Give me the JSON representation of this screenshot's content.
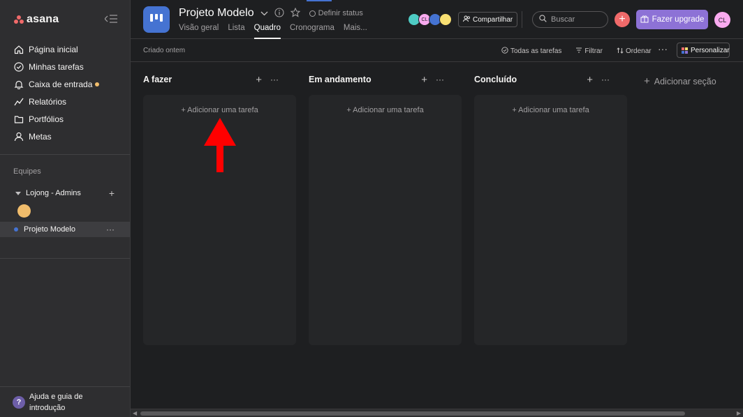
{
  "app": {
    "logo_text": "asana"
  },
  "sidebar": {
    "nav": [
      {
        "label": "Página inicial",
        "icon": "home-icon"
      },
      {
        "label": "Minhas tarefas",
        "icon": "check-circle-icon"
      },
      {
        "label": "Caixa de entrada",
        "icon": "bell-icon"
      },
      {
        "label": "Relatórios",
        "icon": "chart-line-icon"
      },
      {
        "label": "Portfólios",
        "icon": "folder-icon"
      },
      {
        "label": "Metas",
        "icon": "person-icon"
      }
    ],
    "teams_title": "Equipes",
    "team_name": "Lojong - Admins",
    "project_name": "Projeto Modelo",
    "help_text": "Ajuda e guia de introdução"
  },
  "header": {
    "project_title": "Projeto Modelo",
    "status_label": "Definir status",
    "tabs": [
      "Visão geral",
      "Lista",
      "Quadro",
      "Cronograma",
      "Mais..."
    ],
    "active_tab": "Quadro",
    "avatar_initials": "CL",
    "share_label": "Compartilhar",
    "search_placeholder": "Buscar",
    "upgrade_label": "Fazer upgrade",
    "user_initials": "CL"
  },
  "toolbar": {
    "created_text": "Criado ontem",
    "all_tasks": "Todas as tarefas",
    "filter": "Filtrar",
    "sort": "Ordenar",
    "personalize": "Personalizar"
  },
  "board": {
    "columns": [
      {
        "title": "A fazer",
        "add_task": "+ Adicionar uma tarefa"
      },
      {
        "title": "Em andamento",
        "add_task": "+ Adicionar uma tarefa"
      },
      {
        "title": "Concluído",
        "add_task": "+ Adicionar uma tarefa"
      }
    ],
    "add_section": "Adicionar seção"
  },
  "colors": {
    "accent_red": "#f06a6a",
    "upgrade_purple": "#8d72d6",
    "project_blue": "#4573d2",
    "annotation_arrow": "#ff0000"
  }
}
